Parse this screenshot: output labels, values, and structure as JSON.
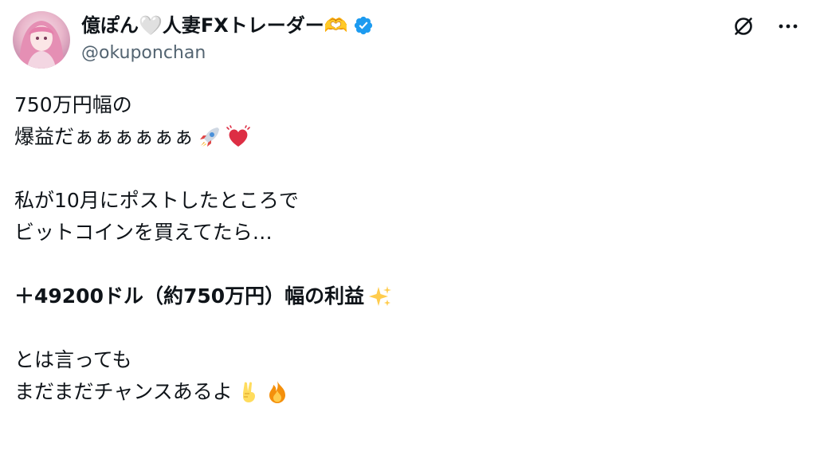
{
  "author": {
    "display_name": "億ぽん🤍人妻FXトレーダー🫶",
    "handle": "@okuponchan",
    "verified": true
  },
  "actions": {
    "grok_icon": "slash-circle-icon",
    "more_icon": "more-dots-icon"
  },
  "post": {
    "line1": "750万円幅の",
    "line2": "爆益だぁぁぁぁぁぁ",
    "line3": "私が10月にポストしたところで",
    "line4": "ビットコインを買えてたら…",
    "line5": "＋49200ドル（約750万円）幅の利益",
    "line6": "とは言っても",
    "line7": "まだまだチャンスあるよ"
  },
  "colors": {
    "text": "#0f1419",
    "secondary": "#536471",
    "verified": "#1d9bf0"
  }
}
